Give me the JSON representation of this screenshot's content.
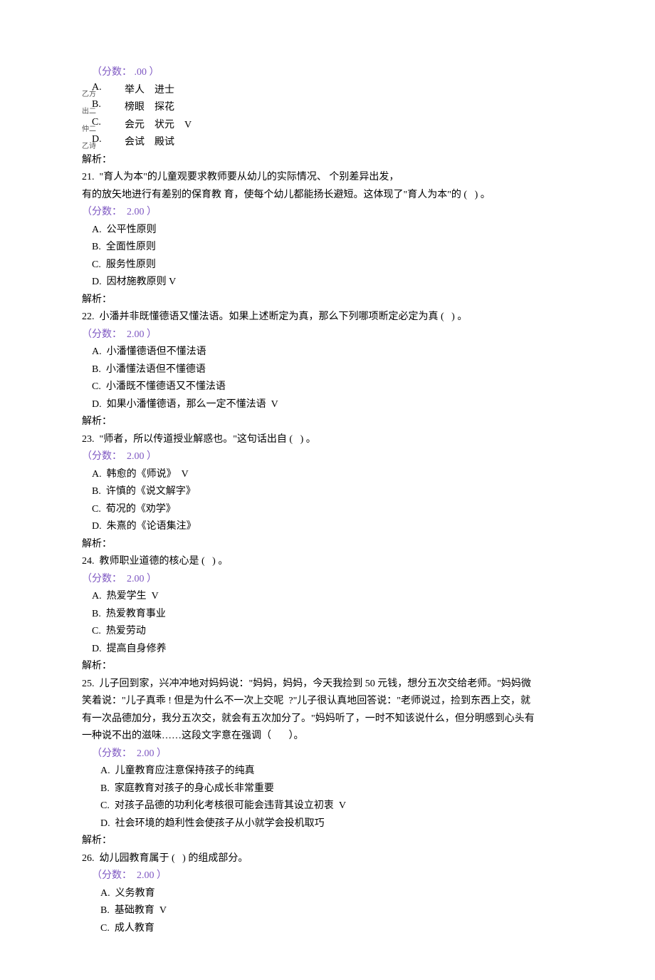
{
  "q_pre": {
    "score_label_html": "（分数： .00 ）",
    "opts": [
      {
        "letter": "A.",
        "sub": "乙方",
        "w1": "举人",
        "w2": "进士",
        "mark": ""
      },
      {
        "letter": "B.",
        "sub": "出二",
        "w1": "榜眼",
        "w2": "探花",
        "mark": ""
      },
      {
        "letter": "C.",
        "sub": "仲二",
        "w1": "会元",
        "w2": "状元",
        "mark": "V"
      },
      {
        "letter": "D.",
        "sub": "乙诗",
        "w1": "会试",
        "w2": "殿试",
        "mark": ""
      }
    ],
    "jiexi": "解析："
  },
  "q21": {
    "stem1": "21.  \"育人为本\"的儿童观要求教师要从幼儿的实际情况、 个别差异出发，",
    "stem2": "有的放矢地进行有差别的保育教 育，使每个幼儿都能扬长避短。这体现了\"育人为本\"的 (   ) 。",
    "score": "（分数：  2.00 ）",
    "A": "A.  公平性原则",
    "B": "B.  全面性原则",
    "C": "C.  服务性原则",
    "D": "D.  因材施教原则 V",
    "jiexi": "解析："
  },
  "q22": {
    "stem": "22.  小潘并非既懂德语又懂法语。如果上述断定为真，那么下列哪项断定必定为真 (   ) 。",
    "score": "（分数：  2.00 ）",
    "A": "A.  小潘懂德语但不懂法语",
    "B": "B.  小潘懂法语但不懂德语",
    "C": "C.  小潘既不懂德语又不懂法语",
    "D": "D.  如果小潘懂德语，那么一定不懂法语  V",
    "jiexi": "解析："
  },
  "q23": {
    "stem": "23.  \"师者，所以传道授业解惑也。\"这句话出自 (   ) 。",
    "score": "（分数：  2.00 ）",
    "A": "A.  韩愈的《师说》  V",
    "B": "B.  许慎的《说文解字》",
    "C": "C.  荀况的《劝学》",
    "D": "D.  朱熹的《论语集注》",
    "jiexi": "解析："
  },
  "q24": {
    "stem": "24.  教师职业道德的核心是 (   ) 。",
    "score": "（分数：  2.00 ）",
    "A": "A.  热爱学生  V",
    "B": "B.  热爱教育事业",
    "C": "C.  热爱劳动",
    "D": "D.  提高自身修养",
    "jiexi": "解析："
  },
  "q25": {
    "stem1": "25.  儿子回到家，兴冲冲地对妈妈说：\"妈妈，妈妈，今天我捡到 50 元钱，想分五次交给老师。\"妈妈微",
    "stem2": "笑着说：\"儿子真乖 ! 但是为什么不一次上交呢  ?\"儿子很认真地回答说：\"老师说过，捡到东西上交，就",
    "stem3": "有一次品德加分，我分五次交，就会有五次加分了。\"妈妈听了，一时不知该说什么，但分明感到心头有",
    "stem4": "一种说不出的滋味……这段文字意在强调（       ）。",
    "score": "（分数：  2.00 ）",
    "A": "A.  儿童教育应注意保持孩子的纯真",
    "B": "B.  家庭教育对孩子的身心成长非常重要",
    "C": "C.  对孩子品德的功利化考核很可能会违背其设立初衷  V",
    "D": "D.  社会环境的趋利性会使孩子从小就学会投机取巧",
    "jiexi": "解析："
  },
  "q26": {
    "stem": "26.  幼儿园教育属于 (   ) 的组成部分。",
    "score": "（分数：  2.00 ）",
    "A": "A.  义务教育",
    "B": "B.  基础教育  V",
    "C": "C.  成人教育"
  }
}
